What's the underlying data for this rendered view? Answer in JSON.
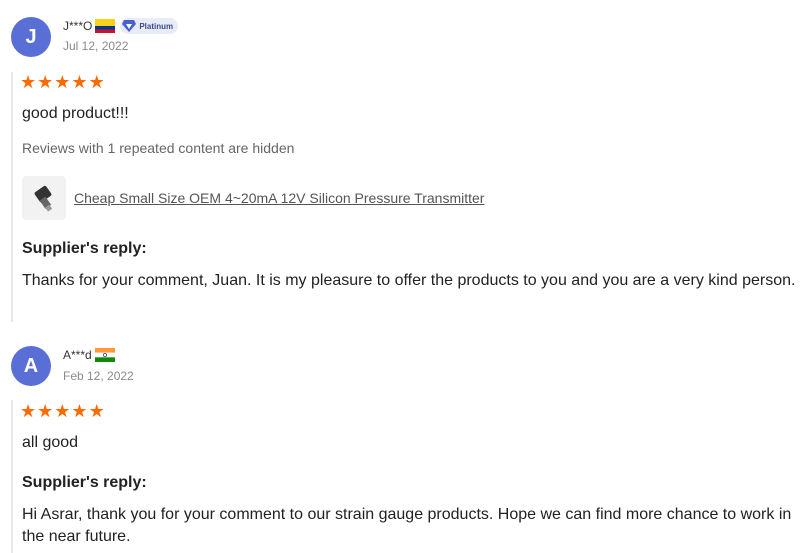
{
  "reviews": [
    {
      "avatar_letter": "J",
      "name": "J***O",
      "flag": "colombia-flag",
      "badge": "Platinum",
      "date": "Jul 12, 2022",
      "rating": 5,
      "text": "good product!!!",
      "hidden_note": "Reviews with 1 repeated content are hidden",
      "product": {
        "thumbnail_icon": "pressure-transmitter-icon",
        "title": "Cheap Small Size OEM 4~20mA 12V Silicon Pressure Transmitter"
      },
      "reply_title": "Supplier's reply:",
      "reply": "Thanks for your comment, Juan. It is my pleasure to offer the products to you and you are a very kind person."
    },
    {
      "avatar_letter": "A",
      "name": "A***d",
      "flag": "india-flag",
      "date": "Feb 12, 2022",
      "rating": 5,
      "text": "all good",
      "reply_title": "Supplier's reply:",
      "reply": "Hi Asrar, thank you for your comment to our strain gauge products. Hope we can find more chance to work in the near future."
    }
  ],
  "colors": {
    "avatar": "#5a6fd6",
    "star": "#ff6a00",
    "badge_bg": "#e8ecf8"
  }
}
